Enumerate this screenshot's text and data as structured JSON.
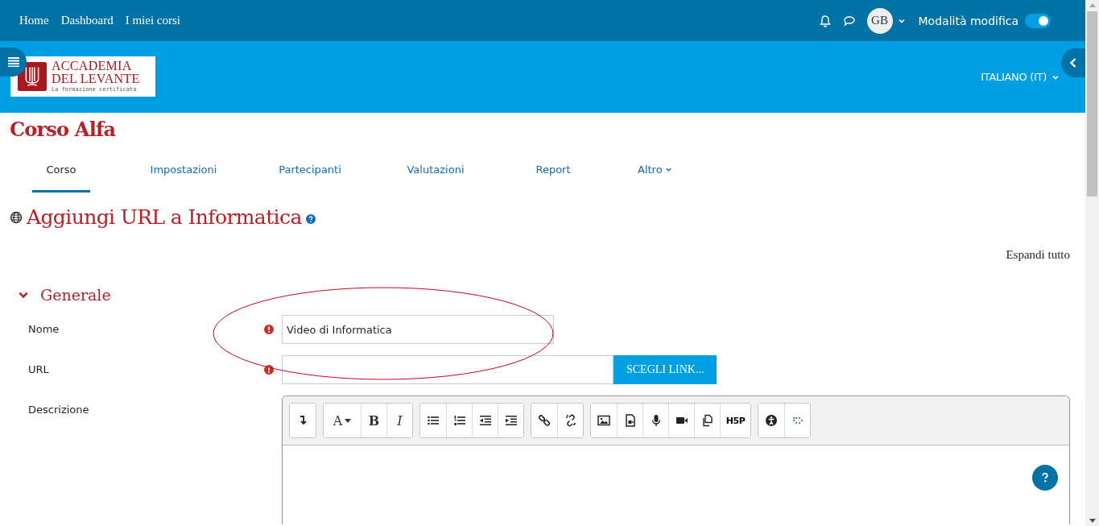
{
  "top_nav": {
    "links": [
      "Home",
      "Dashboard",
      "I miei corsi"
    ],
    "avatar": "GB",
    "edit_mode": {
      "label": "Modalità modifica",
      "on": true
    }
  },
  "header": {
    "logo": {
      "line1": "ACCADEMIA",
      "line2": "DEL LEVANTE",
      "tagline": "La formazione certificata"
    },
    "language": "ITALIANO (IT)"
  },
  "course_title": "Corso Alfa",
  "tabs": [
    {
      "label": "Corso",
      "selected": true,
      "dropdown": false
    },
    {
      "label": "Impostazioni",
      "selected": false,
      "dropdown": false
    },
    {
      "label": "Partecipanti",
      "selected": false,
      "dropdown": false
    },
    {
      "label": "Valutazioni",
      "selected": false,
      "dropdown": false
    },
    {
      "label": "Report",
      "selected": false,
      "dropdown": false
    },
    {
      "label": "Altro",
      "selected": false,
      "dropdown": true
    }
  ],
  "page_heading": "Aggiungi URL a Informatica",
  "expand_all": "Espandi tutto",
  "section": {
    "title": "Generale",
    "expanded": true
  },
  "fields": [
    {
      "kind": "text",
      "label": "Nome",
      "required": true,
      "value": "Video di Informatica"
    },
    {
      "kind": "url",
      "label": "URL",
      "required": true,
      "button": "SCEGLI LINK..."
    },
    {
      "kind": "editor",
      "label": "Descrizione",
      "required": false
    }
  ],
  "toolbar": [
    [
      {
        "kind": "collapse"
      }
    ],
    [
      {
        "kind": "font",
        "label": "A"
      },
      {
        "kind": "bold",
        "label": "B"
      },
      {
        "kind": "italic",
        "label": "I"
      }
    ],
    [
      {
        "kind": "bullets"
      },
      {
        "kind": "numbers"
      },
      {
        "kind": "outdent"
      },
      {
        "kind": "indent"
      }
    ],
    [
      {
        "kind": "link"
      },
      {
        "kind": "unlink"
      }
    ],
    [
      {
        "kind": "image"
      },
      {
        "kind": "media"
      },
      {
        "kind": "mic"
      },
      {
        "kind": "video"
      },
      {
        "kind": "files"
      },
      {
        "kind": "h5p",
        "label": "H5P"
      }
    ],
    [
      {
        "kind": "accessibility"
      },
      {
        "kind": "braille"
      }
    ]
  ]
}
